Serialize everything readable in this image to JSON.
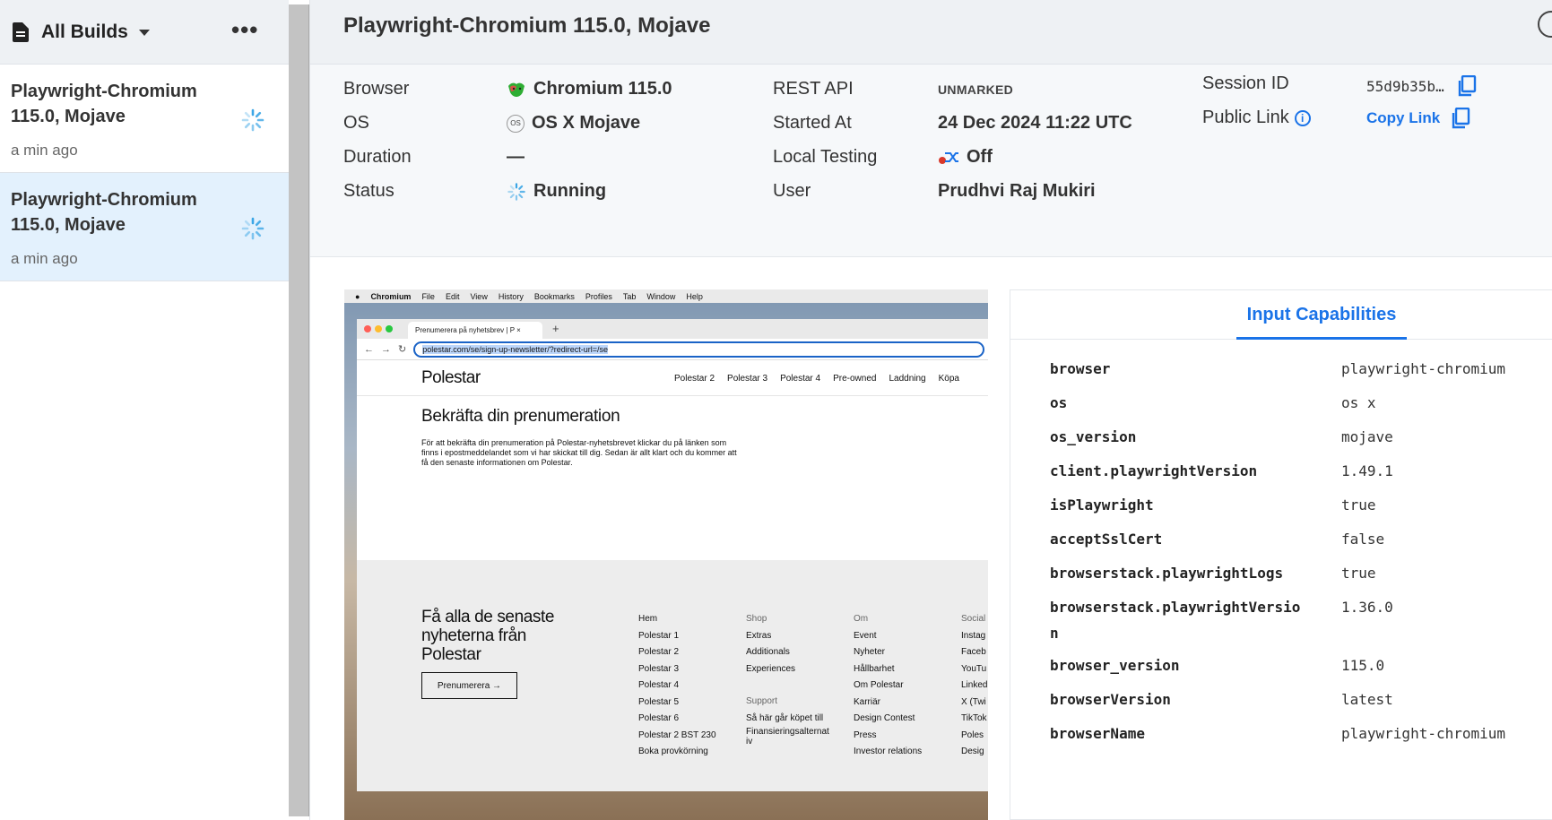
{
  "sidebar": {
    "title": "All Builds",
    "builds": [
      {
        "title": "Playwright-Chromium 115.0, Mojave",
        "time": "a min ago"
      },
      {
        "title": "Playwright-Chromium 115.0, Mojave",
        "time": "a min ago"
      }
    ]
  },
  "header": {
    "title": "Playwright-Chromium 115.0, Mojave"
  },
  "details": {
    "browser_label": "Browser",
    "browser_value": "Chromium 115.0",
    "os_label": "OS",
    "os_value": "OS X Mojave",
    "duration_label": "Duration",
    "duration_value": "—",
    "status_label": "Status",
    "status_value": "Running",
    "rest_label": "REST API",
    "rest_value": "UNMARKED",
    "started_label": "Started At",
    "started_value": "24 Dec 2024 11:22 UTC",
    "local_label": "Local Testing",
    "local_value": "Off",
    "user_label": "User",
    "user_value": "Prudhvi Raj Mukiri",
    "session_label": "Session ID",
    "session_value": "55d9b35b…",
    "public_label": "Public Link",
    "copy_link": "Copy Link",
    "os_badge": "OS"
  },
  "preview": {
    "menubar": [
      "Chromium",
      "File",
      "Edit",
      "View",
      "History",
      "Bookmarks",
      "Profiles",
      "Tab",
      "Window",
      "Help"
    ],
    "tab_title": "Prenumerera på nyhetsbrev | P",
    "url": "polestar.com/se/sign-up-newsletter/?redirect-url=/se",
    "logo": "Polestar",
    "nav": [
      "Polestar 2",
      "Polestar 3",
      "Polestar 4",
      "Pre-owned",
      "Laddning",
      "Köpa"
    ],
    "heading": "Bekräfta din prenumeration",
    "paragraph": "För att bekräfta din prenumeration på Polestar-nyhetsbrevet klickar du på länken som finns i epostmeddelandet som vi har skickat till dig. Sedan är allt klart och du kommer att få den senaste informationen om Polestar.",
    "footer_heading": "Få alla de senaste nyheterna från Polestar",
    "footer_button": "Prenumerera →",
    "col1": [
      "Hem",
      "Polestar 1",
      "Polestar 2",
      "Polestar 3",
      "Polestar 4",
      "Polestar 5",
      "Polestar 6",
      "Polestar 2 BST 230",
      "Boka provkörning"
    ],
    "col2_head": "Shop",
    "col2": [
      "Extras",
      "Additionals",
      "Experiences"
    ],
    "col2b_head": "Support",
    "col2b": [
      "Så här går köpet till",
      "Finansieringsalternat",
      "iv"
    ],
    "col3_head": "Om",
    "col3": [
      "Event",
      "Nyheter",
      "Hållbarhet",
      "Om Polestar",
      "Karriär",
      "Design Contest",
      "Press",
      "Investor relations"
    ],
    "col4_head": "Social",
    "col4": [
      "Instag",
      "Faceb",
      "YouTu",
      "Linked",
      "X (Twi",
      "TikTok",
      "Poles",
      "Desig"
    ]
  },
  "capabilities": {
    "tab_label": "Input Capabilities",
    "rows": [
      {
        "key": "browser",
        "value": "playwright-chromium"
      },
      {
        "key": "os",
        "value": "os x"
      },
      {
        "key": "os_version",
        "value": "mojave"
      },
      {
        "key": "client.playwrightVersion",
        "value": "1.49.1"
      },
      {
        "key": "isPlaywright",
        "value": "true"
      },
      {
        "key": "acceptSslCert",
        "value": "false"
      },
      {
        "key": "browserstack.playwrightLogs",
        "value": "true"
      },
      {
        "key": "browserstack.playwrightVersion",
        "value": "1.36.0"
      },
      {
        "key": "browser_version",
        "value": "115.0"
      },
      {
        "key": "browserVersion",
        "value": "latest"
      },
      {
        "key": "browserName",
        "value": "playwright-chromium"
      }
    ]
  },
  "colors": {
    "accent": "#1a73e8",
    "active_bg": "#e3f1fd",
    "header_bg": "#eef1f4"
  }
}
